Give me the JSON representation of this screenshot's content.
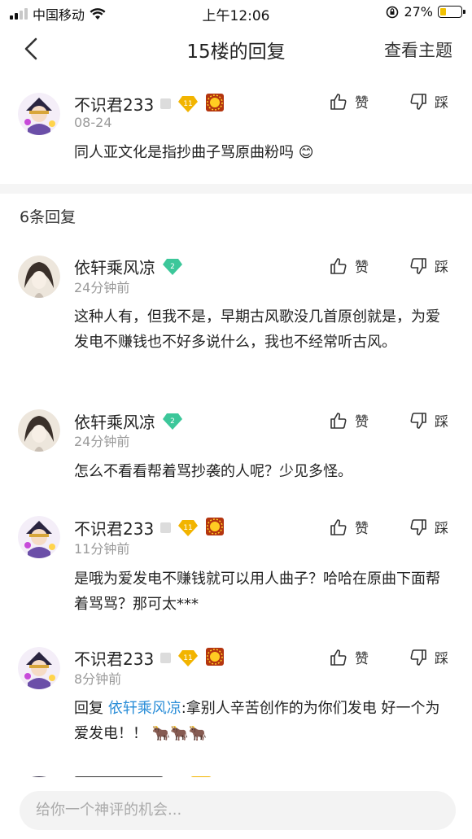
{
  "status_bar": {
    "carrier": "中国移动",
    "time": "上午12:06",
    "battery": "27%"
  },
  "nav": {
    "title": "15楼的回复",
    "action": "查看主题"
  },
  "main_comment": {
    "username": "不识君233",
    "level": "11",
    "time": "08-24",
    "text": "同人亚文化是指抄曲子骂原曲粉吗",
    "like_label": "赞",
    "dislike_label": "踩"
  },
  "replies_count": "6条回复",
  "replies": [
    {
      "username": "依轩乘风凉",
      "level": "2",
      "time": "24分钟前",
      "text": "这种人有，但我不是，早期古风歌没几首原创就是，为爱发电不赚钱也不好多说什么，我也不经常听古风。",
      "like_label": "赞",
      "dislike_label": "踩"
    },
    {
      "username": "依轩乘风凉",
      "level": "2",
      "time": "24分钟前",
      "text": "怎么不看看帮着骂抄袭的人呢？少见多怪。",
      "like_label": "赞",
      "dislike_label": "踩"
    },
    {
      "username": "不识君233",
      "level": "11",
      "time": "11分钟前",
      "text": "是哦为爱发电不赚钱就可以用人曲子？哈哈在原曲下面帮着骂骂？那可太***",
      "like_label": "赞",
      "dislike_label": "踩"
    },
    {
      "username": "不识君233",
      "level": "11",
      "time": "8分钟前",
      "reply_prefix": "回复",
      "mention": "依轩乘风凉",
      "text": ":拿别人辛苦创作的为你们发电 好一个为爱发电！！",
      "emoji": "🐂🐂🐂",
      "like_label": "赞",
      "dislike_label": "踩"
    }
  ],
  "bottom": {
    "input_placeholder": "给你一个神评的机会..."
  },
  "colors": {
    "mention": "#2b8ed8",
    "level_gold": "#f2b400",
    "level_green": "#3cc79a"
  }
}
